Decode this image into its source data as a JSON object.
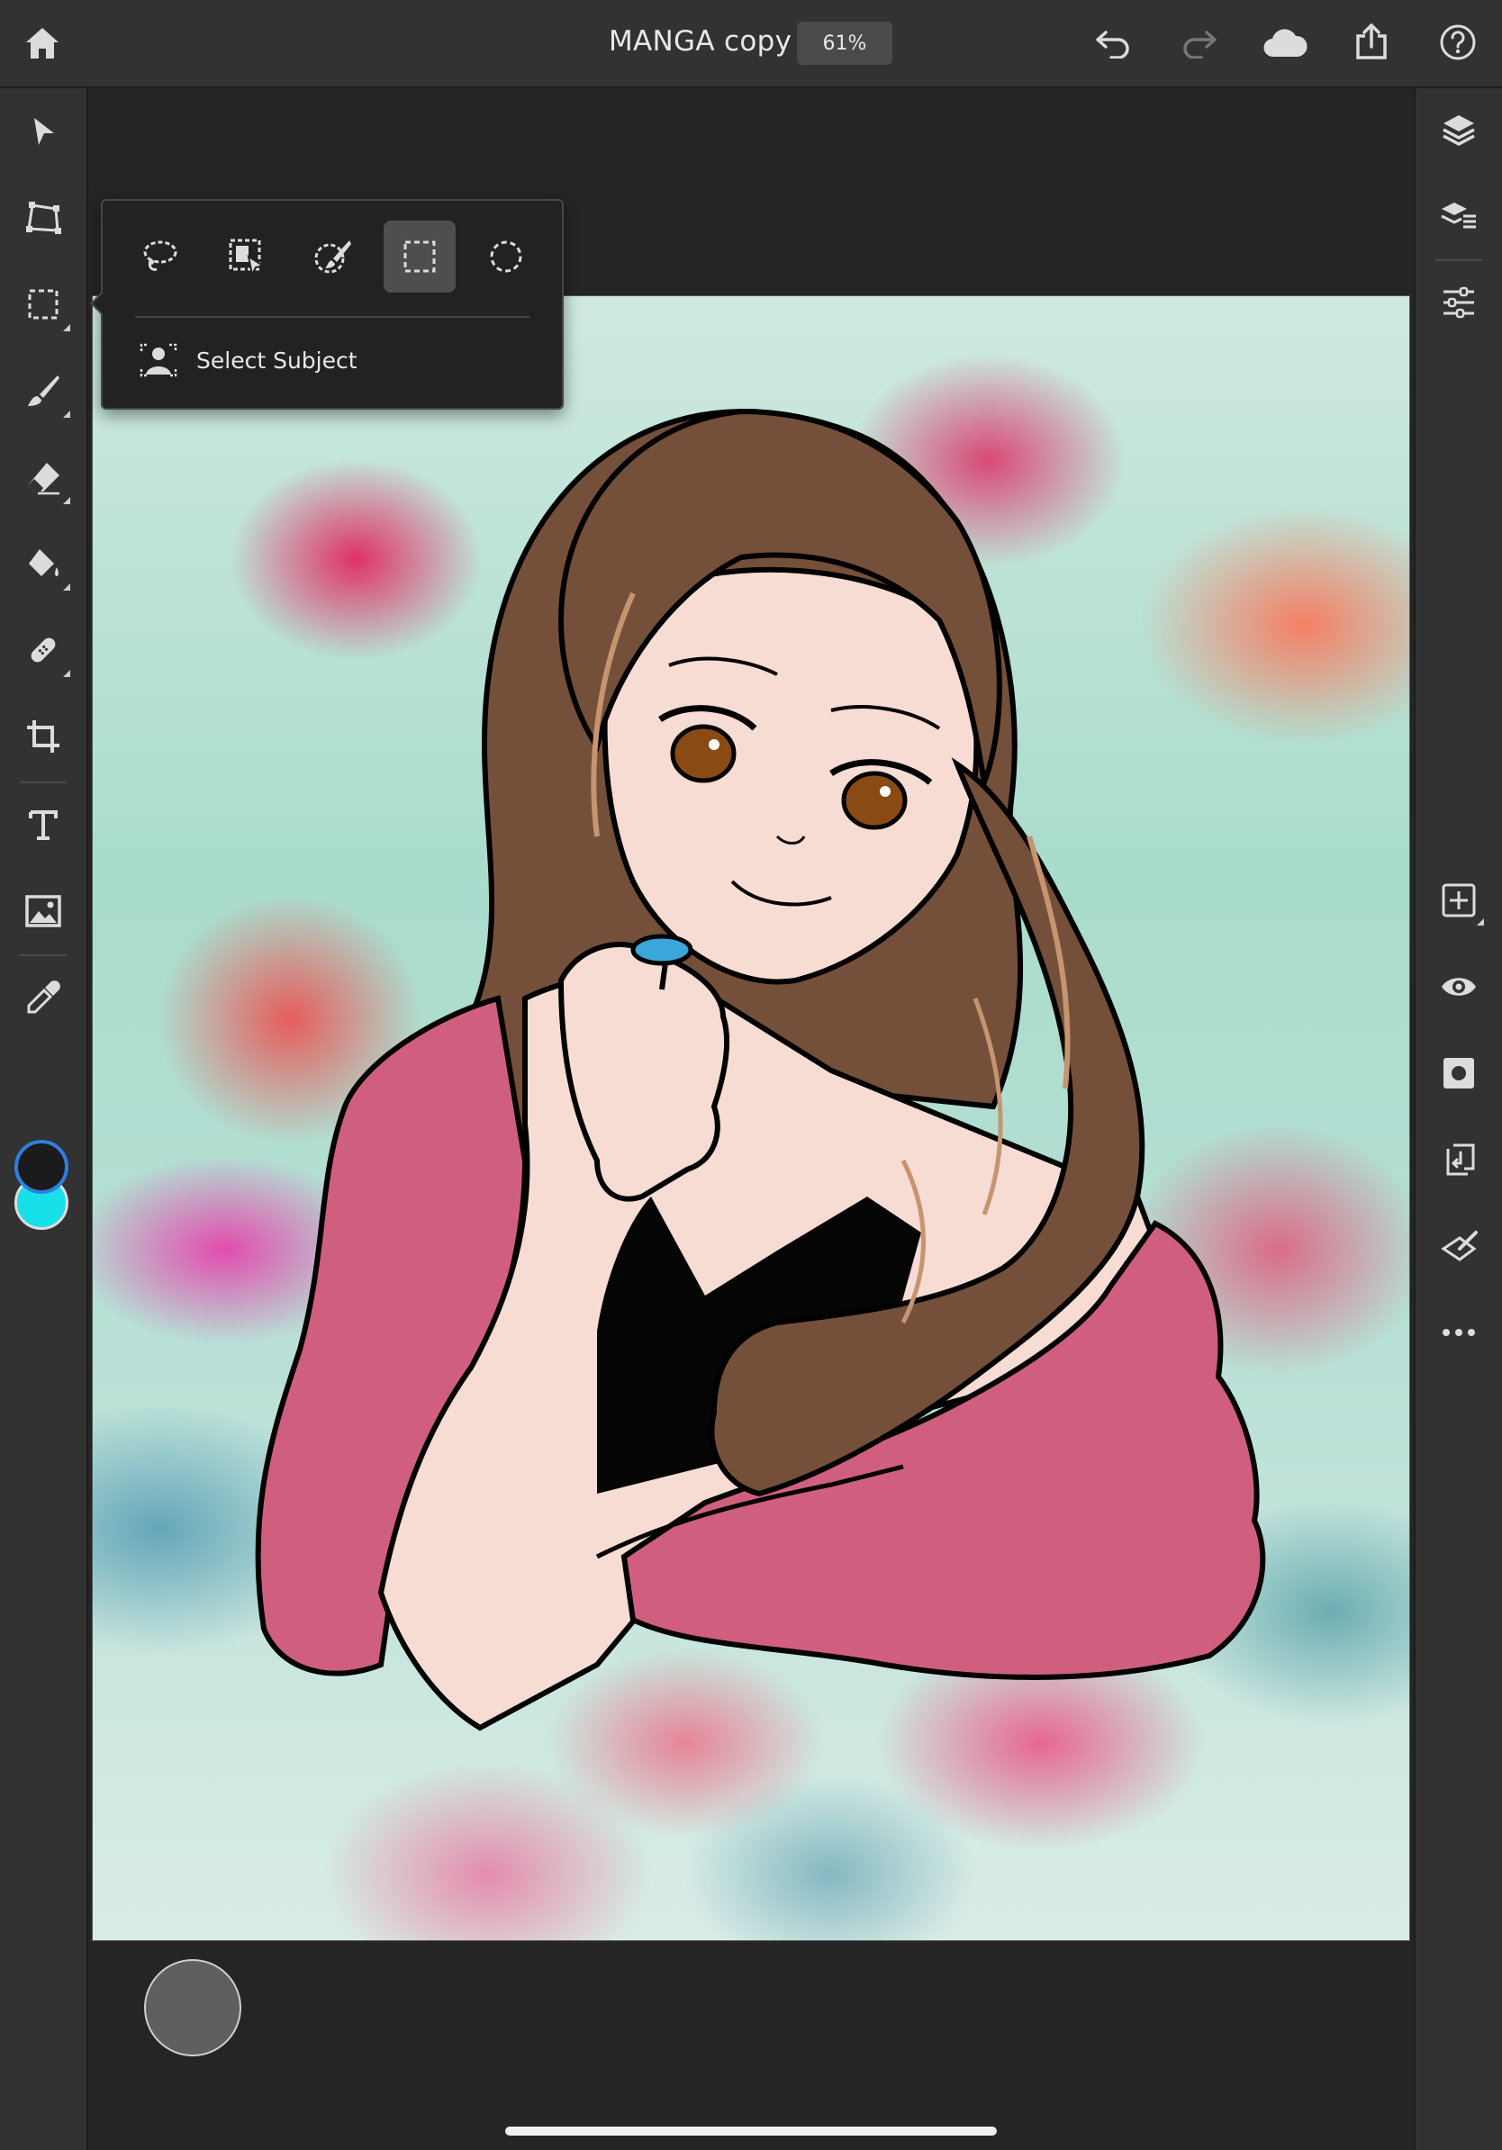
{
  "document": {
    "title": "MANGA copy",
    "zoom": "61%"
  },
  "topbar": {
    "icons": [
      "home-icon",
      "undo-icon",
      "redo-icon",
      "cloud-icon",
      "share-icon",
      "help-icon"
    ]
  },
  "left_toolbar": {
    "tools": [
      "move-tool",
      "transform-tool",
      "selection-tool",
      "brush-tool",
      "eraser-tool",
      "fill-tool",
      "healing-tool",
      "crop-tool",
      "type-tool",
      "place-image-tool",
      "eyedropper-tool"
    ],
    "foreground_color": "#1b1b1b",
    "background_color": "#18e0ea"
  },
  "selection_popover": {
    "tools": [
      "lasso-select",
      "object-select",
      "quick-select",
      "rectangular-marquee",
      "elliptical-marquee"
    ],
    "active_tool": "rectangular-marquee",
    "select_subject_label": "Select Subject"
  },
  "right_panel": {
    "icons": [
      "layers-icon",
      "layer-properties-icon",
      "adjustments-icon",
      "add-layer-icon",
      "visibility-icon",
      "mask-icon",
      "clipping-icon",
      "refine-icon",
      "more-icon"
    ]
  },
  "colors": {
    "chrome": "#323232",
    "workspace": "#252525",
    "accent": "#2f7ee0"
  }
}
